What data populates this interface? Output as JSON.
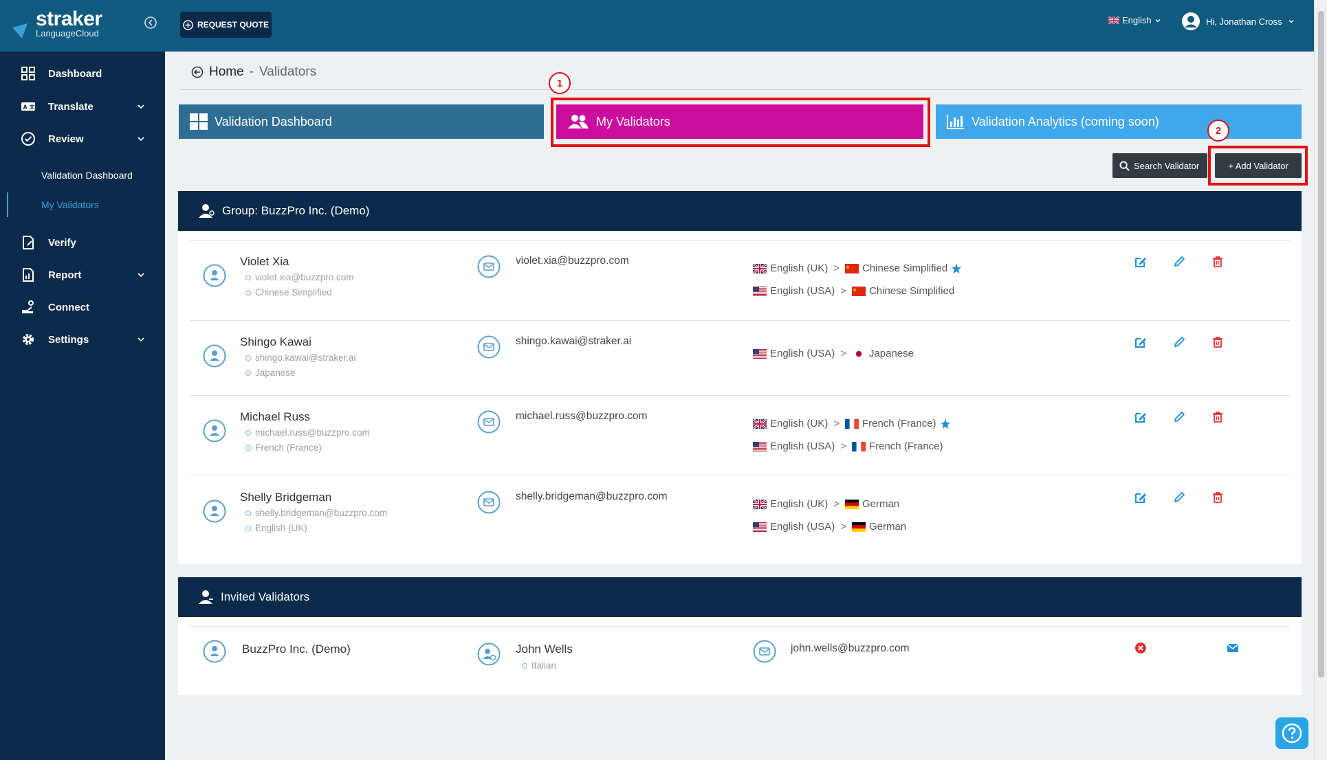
{
  "header": {
    "logo_main": "straker",
    "logo_sub": "LanguageCloud",
    "request_quote": "REQUEST QUOTE",
    "language": "English",
    "user": "Hi, Jonathan Cross"
  },
  "sidebar": {
    "items": [
      {
        "label": "Dashboard"
      },
      {
        "label": "Translate"
      },
      {
        "label": "Review"
      },
      {
        "label": "Verify"
      },
      {
        "label": "Report"
      },
      {
        "label": "Connect"
      },
      {
        "label": "Settings"
      }
    ],
    "review_sub": [
      {
        "label": "Validation Dashboard"
      },
      {
        "label": "My Validators"
      }
    ]
  },
  "breadcrumb": {
    "home": "Home",
    "separator": "-",
    "current": "Validators"
  },
  "tabs": [
    {
      "label": "Validation Dashboard"
    },
    {
      "label": "My Validators"
    },
    {
      "label": "Validation Analytics (coming soon)"
    }
  ],
  "steps": [
    "1",
    "2"
  ],
  "buttons": {
    "search": "Search Validator",
    "add": "+ Add Validator"
  },
  "group": {
    "title": "Group: BuzzPro Inc. (Demo)",
    "validators": [
      {
        "name": "Violet Xia",
        "sub_email": "violet.xia@buzzpro.com",
        "sub_lang": "Chinese Simplified",
        "email": "violet.xia@buzzpro.com",
        "pairs": [
          {
            "src": "English (UK)",
            "tgt": "Chinese Simplified",
            "star": true
          },
          {
            "src": "English (USA)",
            "tgt": "Chinese Simplified",
            "star": false
          }
        ]
      },
      {
        "name": "Shingo Kawai",
        "sub_email": "shingo.kawai@straker.ai",
        "sub_lang": "Japanese",
        "email": "shingo.kawai@straker.ai",
        "pairs": [
          {
            "src": "English (USA)",
            "tgt": "Japanese",
            "star": false
          }
        ]
      },
      {
        "name": "Michael Russ",
        "sub_email": "michael.russ@buzzpro.com",
        "sub_lang": "French (France)",
        "email": "michael.russ@buzzpro.com",
        "pairs": [
          {
            "src": "English (UK)",
            "tgt": "French (France)",
            "star": true
          },
          {
            "src": "English (USA)",
            "tgt": "French (France)",
            "star": false
          }
        ]
      },
      {
        "name": "Shelly Bridgeman",
        "sub_email": "shelly.bridgeman@buzzpro.com",
        "sub_lang": "English (UK)",
        "email": "shelly.bridgeman@buzzpro.com",
        "pairs": [
          {
            "src": "English (UK)",
            "tgt": "German",
            "star": false
          },
          {
            "src": "English (USA)",
            "tgt": "German",
            "star": false
          }
        ]
      }
    ]
  },
  "invited": {
    "title": "Invited Validators",
    "rows": [
      {
        "group": "BuzzPro Inc. (Demo)",
        "name": "John Wells",
        "lang": "Italian",
        "email": "john.wells@buzzpro.com"
      }
    ]
  },
  "colors": {
    "primary": "#10597f",
    "sidebar": "#0b2a49",
    "tab_active": "#cc0c9c",
    "tab_analytics": "#41a7eb",
    "highlight": "#e01313"
  }
}
